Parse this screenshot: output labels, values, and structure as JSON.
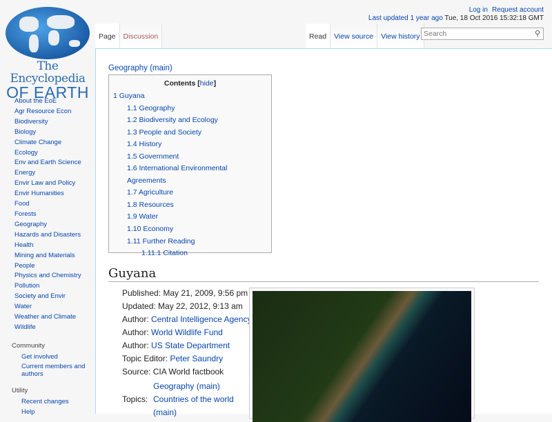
{
  "logo": {
    "line1": "The Encyclopedia",
    "line2": "OF EARTH"
  },
  "header": {
    "login": "Log in",
    "request_account": "Request account",
    "last_updated_label": "Last updated 1 year ago",
    "last_updated_date": "Tue, 18 Oct 2016 15:32:18 GMT"
  },
  "tabs": {
    "page": "Page",
    "discussion": "Discussion",
    "read": "Read",
    "view_source": "View source",
    "view_history": "View history"
  },
  "search": {
    "placeholder": "Search",
    "icon": "search-icon"
  },
  "sidebar": {
    "nav": [
      "About the EoE",
      "Agr Resource Econ",
      "Biodiversity",
      "Biology",
      "Climate Change",
      "Ecology",
      "Env and Earth Science",
      "Energy",
      "Envir Law and Policy",
      "Envir Humanities",
      "Food",
      "Forests",
      "Geography",
      "Hazards and Disasters",
      "Health",
      "Mining and Materials",
      "People",
      "Physics and Chemistry",
      "Pollution",
      "Society and Envir",
      "Water",
      "Weather and Climate",
      "Wildlife"
    ],
    "community": {
      "title": "Community",
      "items": [
        "Get involved",
        "Current members and authors"
      ]
    },
    "utility": {
      "title": "Utility",
      "items": [
        "Recent changes",
        "Help"
      ]
    }
  },
  "breadcrumb": "Geography (main)",
  "toc": {
    "title": "Contents",
    "hide": "hide",
    "entries": [
      {
        "num": "1",
        "text": "Guyana",
        "level": 1
      },
      {
        "num": "1.1",
        "text": "Geography",
        "level": 2
      },
      {
        "num": "1.2",
        "text": "Biodiversity and Ecology",
        "level": 2
      },
      {
        "num": "1.3",
        "text": "People and Society",
        "level": 2
      },
      {
        "num": "1.4",
        "text": "History",
        "level": 2
      },
      {
        "num": "1.5",
        "text": "Government",
        "level": 2
      },
      {
        "num": "1.6",
        "text": "International Environmental Agreements",
        "level": 2
      },
      {
        "num": "1.7",
        "text": "Agriculture",
        "level": 2
      },
      {
        "num": "1.8",
        "text": "Resources",
        "level": 2
      },
      {
        "num": "1.9",
        "text": "Water",
        "level": 2
      },
      {
        "num": "1.10",
        "text": "Economy",
        "level": 2
      },
      {
        "num": "1.11",
        "text": "Further Reading",
        "level": 2
      },
      {
        "num": "1.11.1",
        "text": "Citation",
        "level": 3
      }
    ]
  },
  "article": {
    "title": "Guyana",
    "published": "Published: May 21, 2009, 9:56 pm",
    "updated": "Updated: May 22, 2012, 9:13 am",
    "authors": [
      {
        "label": "Author:",
        "name": "Central Intelligence Agency"
      },
      {
        "label": "Author:",
        "name": "World Wildlife Fund"
      },
      {
        "label": "Author:",
        "name": "US State Department"
      }
    ],
    "topic_editor": {
      "label": "Topic Editor:",
      "name": "Peter Saundry"
    },
    "source": "Source: CIA World factbook",
    "topics_label": "Topics:",
    "topics": [
      "Geography (main)",
      "Countries of the world (main)"
    ]
  }
}
